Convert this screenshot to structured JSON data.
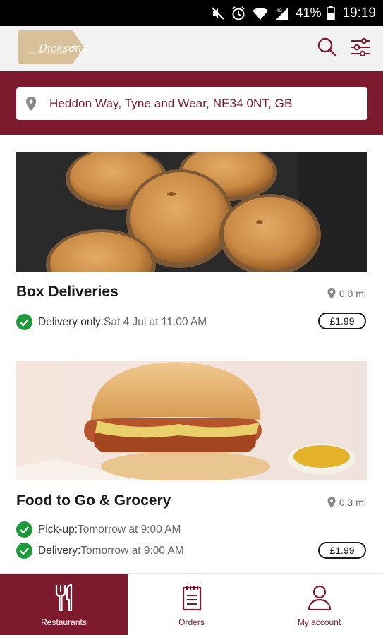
{
  "status_bar": {
    "battery_percent": "41%",
    "time": "19:19",
    "network_label": "4G"
  },
  "header": {
    "logo_text": "Dicksons",
    "search_icon": "search-icon",
    "filter_icon": "filter-sliders-icon"
  },
  "location": {
    "address": "Heddon Way, Tyne and Wear, NE34 0NT, GB",
    "icon": "location-pin-icon"
  },
  "restaurants": [
    {
      "name": "Box Deliveries",
      "distance": "0.0 mi",
      "rows": [
        {
          "label": "Delivery only:",
          "value": " Sat 4 Jul at 11:00 AM"
        }
      ],
      "delivery_fee": "£1.99"
    },
    {
      "name": "Food to Go & Grocery",
      "distance": "0.3 mi",
      "rows": [
        {
          "label": "Pick-up:",
          "value": " Tomorrow at 9:00 AM"
        },
        {
          "label": "Delivery:",
          "value": " Tomorrow at 9:00 AM"
        }
      ],
      "delivery_fee": "£1.99"
    }
  ],
  "bottom_nav": {
    "items": [
      {
        "label": "Restaurants",
        "icon": "fork-knife-icon",
        "active": true
      },
      {
        "label": "Orders",
        "icon": "clipboard-icon",
        "active": false
      },
      {
        "label": "My account",
        "icon": "person-icon",
        "active": false
      }
    ]
  },
  "colors": {
    "brand": "#7d1a2e",
    "logo_tan": "#d8c09a",
    "check_green": "#1e9a3c"
  }
}
